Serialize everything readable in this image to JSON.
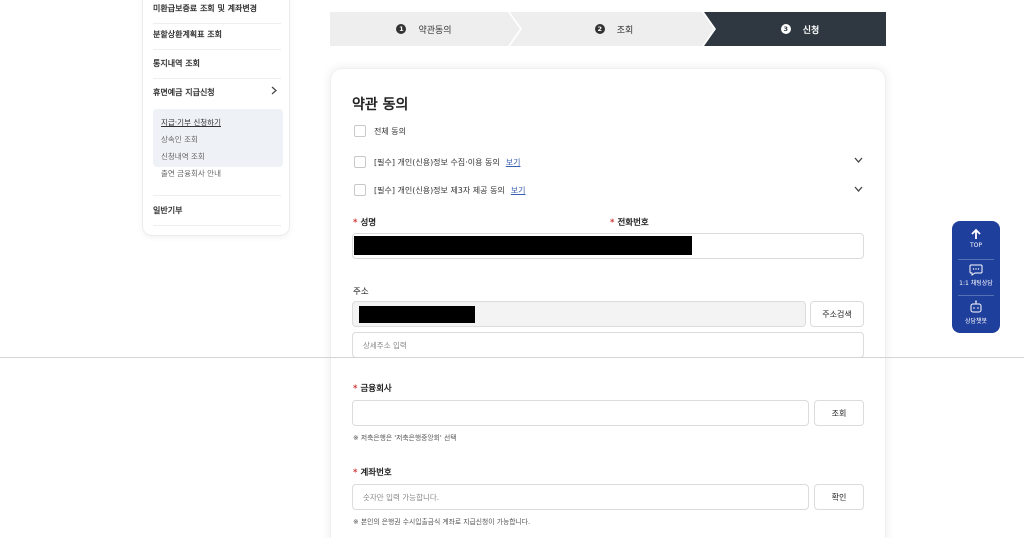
{
  "sidebar": {
    "items": [
      {
        "label": "미환급보증료 조회 및 계좌변경"
      },
      {
        "label": "분할상환계획표 조회"
      },
      {
        "label": "통지내역 조회"
      },
      {
        "label": "휴면예금 지급신청"
      },
      {
        "label": "일반기부"
      }
    ],
    "submenu": [
      {
        "label": "지급·기부 신청하기"
      },
      {
        "label": "상속인 조회"
      },
      {
        "label": "신청내역 조회"
      },
      {
        "label": "출연 금융회사 안내"
      }
    ]
  },
  "steps": [
    {
      "num": "1",
      "label": "약관동의"
    },
    {
      "num": "2",
      "label": "조회"
    },
    {
      "num": "3",
      "label": "신청"
    }
  ],
  "form": {
    "title": "약관 동의",
    "agree_all": "전체 동의",
    "agree_items": [
      {
        "label": "[필수] 개인(신용)정보 수집·이용 동의",
        "link": "보기"
      },
      {
        "label": "[필수] 개인(신용)정보 제3자 제공 동의",
        "link": "보기"
      }
    ],
    "name_label": "성명",
    "phone_label": "전화번호",
    "address_label": "주소",
    "address_search_button": "주소검색",
    "address_detail_placeholder": "상세주소 입력",
    "bank_label": "금융회사",
    "bank_search_button": "조회",
    "bank_note": "※ 저축은행은 '저축은행중앙회' 선택",
    "account_label": "계좌번호",
    "account_placeholder": "숫자만 입력 가능합니다.",
    "account_confirm_button": "확인",
    "account_note": "※ 본인의 은행권 수시입출금식 계좌로 지급신청이 가능합니다.",
    "required_mark": "*"
  },
  "quick_menu": {
    "top": "TOP",
    "chat": "1:1 채팅상담",
    "bot": "상담챗봇"
  },
  "colors": {
    "active_step": "#2f3740",
    "inactive_step": "#eeeeee",
    "quick_menu": "#1f3f9c",
    "required": "#d23b3b",
    "link": "#3a5fb0"
  }
}
